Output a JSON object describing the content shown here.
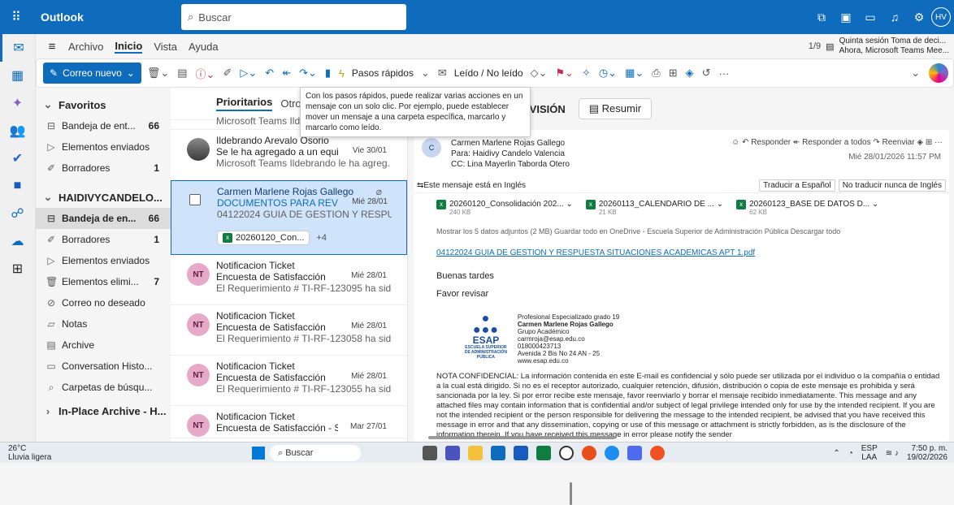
{
  "topbar": {
    "app_name": "Outlook",
    "search_placeholder": "Buscar",
    "user_initials": "HV"
  },
  "ribbon": {
    "tabs": [
      "Archivo",
      "Inicio",
      "Vista",
      "Ayuda"
    ],
    "pager": "1/9",
    "notice_title": "Quinta sesión Toma de deci...",
    "notice_sub": "Ahora, Microsoft Teams Mee..."
  },
  "toolbar": {
    "new_mail": "Correo nuevo",
    "quick_steps": "Pasos rápidos",
    "read_unread": "Leído / No leído",
    "more": "···"
  },
  "tooltip": "Con los pasos rápidos, puede realizar varias acciones en un mensaje con un solo clic. Por ejemplo, puede establecer mover un mensaje a una carpeta específica, marcarlo y marcarlo como leído.",
  "folders": {
    "favorites_title": "Favoritos",
    "fav_inbox": "Bandeja de ent...",
    "fav_inbox_count": "66",
    "fav_sent": "Elementos enviados",
    "fav_drafts": "Borradores",
    "fav_drafts_count": "1",
    "account_title": "HAIDIVYCANDELO...",
    "inbox": "Bandeja de en...",
    "inbox_count": "66",
    "drafts": "Borradores",
    "drafts_count": "1",
    "sent": "Elementos enviados",
    "deleted": "Elementos elimi...",
    "deleted_count": "7",
    "junk": "Correo no deseado",
    "notes": "Notas",
    "archive": "Archive",
    "conversation": "Conversation Histo...",
    "search_folders": "Carpetas de búsqu...",
    "in_place": "In-Place Archive - H..."
  },
  "message_list": {
    "tab_focused": "Prioritarios",
    "tab_other": "Otros",
    "top_preview": "Microsoft Teams Ildet...",
    "messages": [
      {
        "initials": "",
        "from": "Ildebrando Arevalo Osorio",
        "subject": "Se le ha agregado a un equip...",
        "date": "Vie 30/01",
        "preview": "Microsoft Teams Ildebrando le ha agreg..."
      },
      {
        "initials": "",
        "from": "Carmen Marlene Rojas Gallego",
        "subject": "DOCUMENTOS PARA REVISI...",
        "date": "Mié 28/01",
        "preview": "04122024 GUIA DE GESTION Y RESPUES...",
        "attachment": "20260120_Con...",
        "more_attachments": "+4"
      },
      {
        "initials": "NT",
        "from": "Notificacion Ticket",
        "subject": "Encuesta de Satisfacción",
        "date": "Mié 28/01",
        "preview": "El Requerimiento # TI-RF-123095 ha sid..."
      },
      {
        "initials": "NT",
        "from": "Notificacion Ticket",
        "subject": "Encuesta de Satisfacción",
        "date": "Mié 28/01",
        "preview": "El Requerimiento # TI-RF-123058 ha sid..."
      },
      {
        "initials": "NT",
        "from": "Notificacion Ticket",
        "subject": "Encuesta de Satisfacción",
        "date": "Mié 28/01",
        "preview": "El Requerimiento # TI-RF-123055 ha sid..."
      },
      {
        "initials": "NT",
        "from": "Notificacion Ticket",
        "subject": "Encuesta de Satisfacción - So...",
        "date": "Mar 27/01",
        "preview": ""
      }
    ]
  },
  "reading": {
    "subject_tail": "EVISIÓN",
    "summarize": "Resumir",
    "sender_initial": "C",
    "sender": "Carmen Marlene Rojas Gallego",
    "to": "Para: Haidivy Candelo Valencia",
    "cc": "CC: Lina Mayerlin Taborda Otero",
    "reply": "Responder",
    "reply_all": "Responder a todos",
    "forward": "Reenviar",
    "date": "Mié 28/01/2026 11:57 PM",
    "lang_notice": "Este mensaje está en Inglés",
    "translate": "Traducir a Español",
    "no_translate": "No traducir nunca de Inglés",
    "attachments": [
      {
        "name": "20260120_Consolidación 202...",
        "size": "240 KB"
      },
      {
        "name": "20260113_CALENDARIO DE ...",
        "size": "21 KB"
      },
      {
        "name": "20260123_BASE DE DATOS D...",
        "size": "62 KB"
      }
    ],
    "attach_actions": "Mostrar los 5 datos adjuntos (2 MB)    Guardar todo en OneDrive - Escuela Superior de Administración Pública    Descargar todo",
    "pdf_link": "04122024 GUIA DE GESTION Y RESPUESTA SITUACIONES ACADEMICAS APT 1.pdf",
    "greeting": "Buenas tardes",
    "request": "Favor revisar",
    "sig_logo": "ESAP",
    "sig_logo_sub": "ESCUELA SUPERIOR DE ADMINISTRACIÓN PÚBLICA",
    "sig_lines": [
      "Profesional Especializado grado 19",
      "Carmen Marlene Rojas Gallego",
      "Grupo Académico",
      "carmroja@esap.edu.co",
      "018000423713",
      "Avenida 2 Bis No 24 AN - 25",
      "www.esap.edu.co"
    ],
    "legal": "NOTA CONFIDENCIAL: La información contenida en este E-mail es confidencial y sólo puede ser utilizada por el individuo o la compañía o entidad a la cual está dirigido. Si no es el receptor autorizado, cualquier retención, difusión, distribución o copia de este mensaje es prohibida y será sancionada por la ley. Si por error recibe este mensaje, favor reenviarlo y borrar el mensaje recibido inmediatamente. This message and any attached files may contain information that is confidential and/or subject of legal privilege intended only for use by the intended recipient. If you are not the intended recipient or the person responsible for delivering the message to the intended recipient, be advised that you have received this message in error and that any dissemination, copying or use of this message or attachment is strictly forbidden, as is the disclosure of the information therein. If you have received this message in error please notify the sender"
  },
  "taskbar": {
    "temp": "26°C",
    "weather": "Lluvia ligera",
    "search": "Buscar",
    "lang": "ESP",
    "lang2": "LAA",
    "time": "7:50 p. m.",
    "date": "19/02/2026"
  },
  "colors": {
    "accent": "#0f6cbd",
    "selected_bg": "#cfe4fa"
  }
}
